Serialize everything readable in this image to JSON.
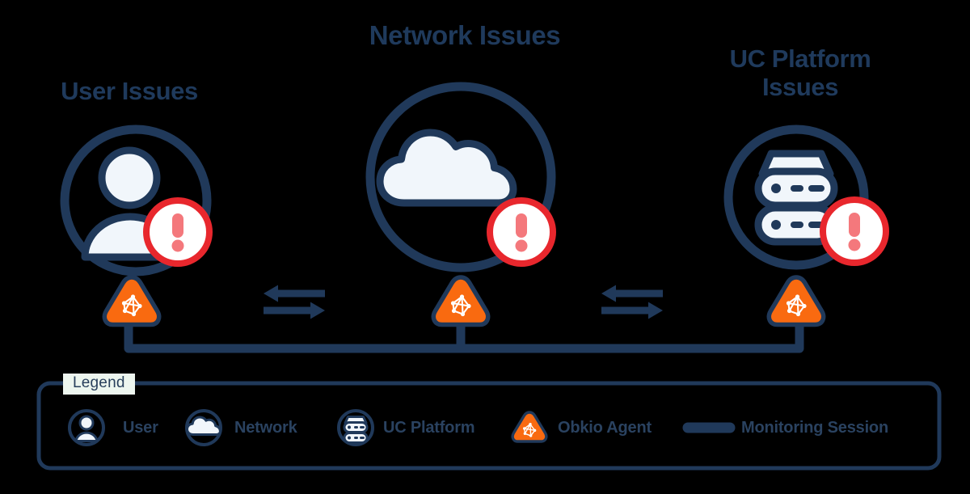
{
  "diagram": {
    "title_user": "User Issues",
    "title_network": "Network Issues",
    "title_uc": "UC Platform\nIssues",
    "colors": {
      "navy": "#1F3A5C",
      "navy_dark": "#20395A",
      "orange": "#F96A10",
      "alert_red": "#E8272D",
      "alert_mark": "#F4787C",
      "icon_fill": "#F1F6FB",
      "legend_tag_bg": "#EDF6EF",
      "text_navy": "#2A4260"
    },
    "nodes": [
      {
        "id": "user",
        "label": "User Issues",
        "icon": "user-icon",
        "has_alert": true,
        "has_agent": true
      },
      {
        "id": "network",
        "label": "Network Issues",
        "icon": "cloud-icon",
        "has_alert": true,
        "has_agent": true
      },
      {
        "id": "uc",
        "label": "UC Platform Issues",
        "icon": "server-icon",
        "has_alert": true,
        "has_agent": true
      }
    ],
    "connections": [
      {
        "from": "user",
        "to": "network",
        "type": "bidirectional-arrows"
      },
      {
        "from": "network",
        "to": "uc",
        "type": "bidirectional-arrows"
      },
      {
        "from": "user",
        "to": "uc",
        "type": "monitoring-session-bracket"
      }
    ]
  },
  "legend": {
    "tag": "Legend",
    "items": [
      {
        "icon": "user-icon",
        "label": "User"
      },
      {
        "icon": "cloud-icon",
        "label": "Network"
      },
      {
        "icon": "server-icon",
        "label": "UC Platform"
      },
      {
        "icon": "obkio-agent-icon",
        "label": "Obkio Agent"
      },
      {
        "icon": "monitoring-session-line",
        "label": "Monitoring Session"
      }
    ]
  }
}
